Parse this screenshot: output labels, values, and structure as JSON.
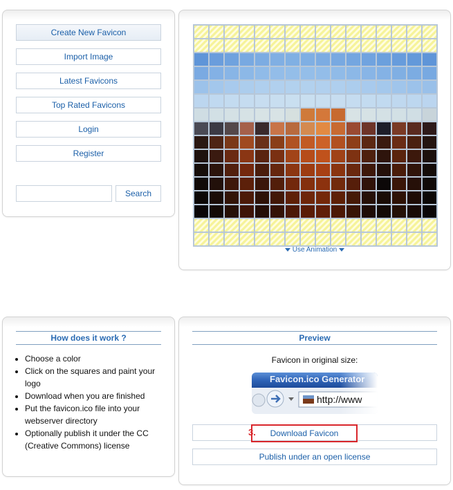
{
  "nav": {
    "items": [
      {
        "label": "Create New Favicon"
      },
      {
        "label": "Import Image"
      },
      {
        "label": "Latest Favicons"
      },
      {
        "label": "Top Rated Favicons"
      },
      {
        "label": "Login"
      },
      {
        "label": "Register"
      }
    ],
    "search_value": "",
    "search_label": "Search"
  },
  "editor": {
    "animation_label": "Use Animation"
  },
  "howto": {
    "title": "How does it work ?",
    "steps": [
      "Choose a color",
      "Click on the squares and paint your logo",
      "Download when you are finished",
      "Put the favicon.ico file into your webserver directory",
      "Optionally publish it under the CC (Creative Commons) license"
    ]
  },
  "preview": {
    "title": "Preview",
    "original_size_label": "Favicon in original size:",
    "browser_title": "Favicon.ico Generator",
    "address_text": "http://www",
    "step_number": "3.",
    "download_label": "Download Favicon",
    "publish_label": "Publish under an open license"
  },
  "colors": {
    "accent": "#2a6bb3",
    "highlight_red": "#d9262b",
    "grid_line": "#b7c7d8"
  }
}
